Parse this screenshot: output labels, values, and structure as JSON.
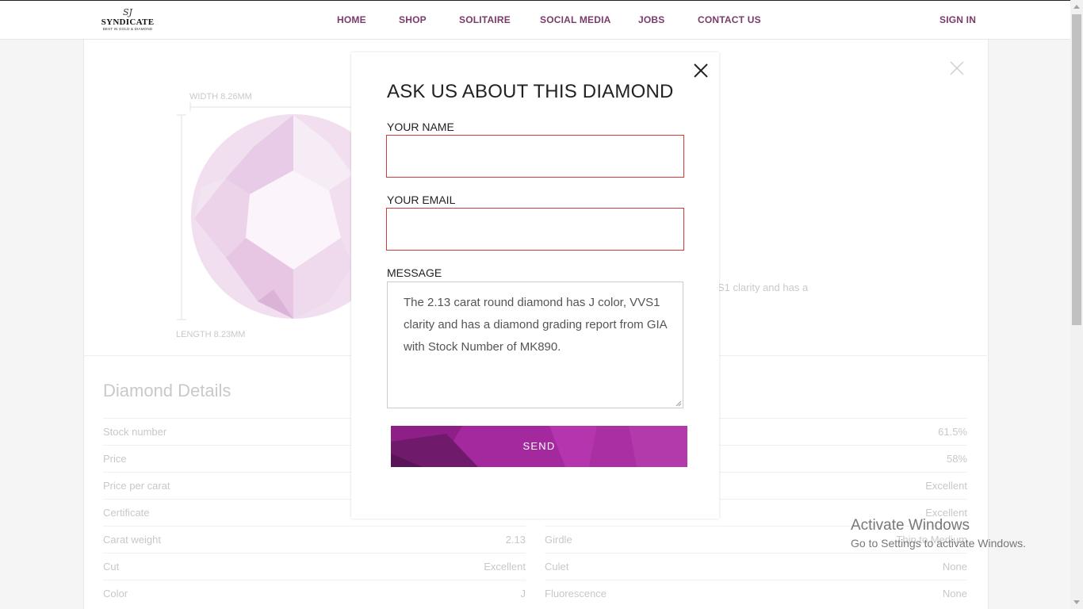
{
  "header": {
    "logo": {
      "mark": "SJ",
      "brand": "SYNDICATE",
      "tagline": "BEST IN GOLD & DIAMOND"
    },
    "nav": [
      "HOME",
      "SHOP",
      "SOLITAIRE",
      "SOCIAL MEDIA",
      "JOBS",
      "CONTACT US"
    ],
    "sign_in": "SIGN IN"
  },
  "diamond_view": {
    "width_label": "WIDTH 8.26MM",
    "length_label": "LENGTH 8.23MM",
    "description_fragment": "S1 clarity and has a"
  },
  "details": {
    "title": "Diamond Details",
    "left_rows": [
      {
        "key": "Stock number",
        "value": ""
      },
      {
        "key": "Price",
        "value": ""
      },
      {
        "key": "Price per carat",
        "value": ""
      },
      {
        "key": "Certificate",
        "value": ""
      },
      {
        "key": "Carat weight",
        "value": "2.13"
      },
      {
        "key": "Cut",
        "value": "Excellent"
      },
      {
        "key": "Color",
        "value": "J"
      }
    ],
    "right_rows": [
      {
        "key": "",
        "value": "61.5%"
      },
      {
        "key": "",
        "value": "58%"
      },
      {
        "key": "",
        "value": "Excellent"
      },
      {
        "key": "",
        "value": "Excellent"
      },
      {
        "key": "Girdle",
        "value": "Thin to Medium"
      },
      {
        "key": "Culet",
        "value": "None"
      },
      {
        "key": "Fluorescence",
        "value": "None"
      }
    ]
  },
  "modal": {
    "title": "ASK US ABOUT THIS DIAMOND",
    "name_label": "YOUR NAME",
    "name_value": "",
    "email_label": "YOUR EMAIL",
    "email_value": "",
    "message_label": "MESSAGE",
    "message_value": "The 2.13 carat round diamond has J color, VVS1 clarity and has a diamond grading report from GIA with Stock Number of MK890.",
    "send_label": "SEND"
  },
  "watermark": {
    "line1": "Activate Windows",
    "line2": "Go to Settings to activate Windows."
  },
  "colors": {
    "accent": "#a4299e",
    "nav_text": "#7b3a6a",
    "error_border": "#d33a3a"
  }
}
